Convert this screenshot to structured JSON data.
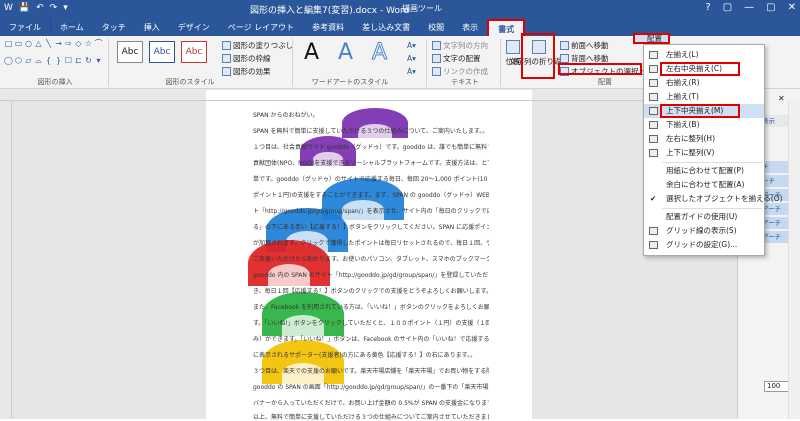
{
  "title_bar": {
    "doc_title": "図形の挿入と編集7(変習).docx - Word",
    "context_title": "描画ツール",
    "qat": [
      "W",
      "💾",
      "↶",
      "↷",
      "▾"
    ],
    "window_controls": [
      "?",
      "▢",
      "—",
      "▢",
      "✕"
    ]
  },
  "tabs": [
    "ファイル",
    "ホーム",
    "タッチ",
    "挿入",
    "デザイン",
    "ページ レイアウト",
    "参考資料",
    "差し込み文書",
    "校閲",
    "表示",
    "書式"
  ],
  "ribbon": {
    "shape_style_labels": [
      "Abc",
      "Abc",
      "Abc"
    ],
    "fill_label": "図形の塗りつぶし",
    "outline_label": "図形の枠線",
    "effects_label": "図形の効果",
    "wordart_letters": [
      "A",
      "A",
      "A"
    ],
    "text_direction_label": "文字列の方向",
    "align_text_label": "文字の配置",
    "create_link_label": "リンクの作成",
    "position_label": "位置",
    "wrap_text_label": "文字列の折り返し",
    "bring_forward_label": "前面へ移動",
    "send_backward_label": "背面へ移動",
    "selection_pane_label": "オブジェクトの選択と表示",
    "arrange_label": "配置",
    "groups": [
      "図形の挿入",
      "図形のスタイル",
      "ワードアートのスタイル",
      "テキスト",
      "配置"
    ]
  },
  "menu": {
    "items": [
      {
        "label": "左揃え(L)",
        "icon": "align-left-icon"
      },
      {
        "label": "左右中央揃え(C)",
        "icon": "align-center-icon"
      },
      {
        "label": "右揃え(R)",
        "icon": "align-right-icon"
      },
      {
        "label": "上揃え(T)",
        "icon": "align-top-icon"
      },
      {
        "label": "上下中央揃え(M)",
        "icon": "align-middle-icon"
      },
      {
        "label": "下揃え(B)",
        "icon": "align-bottom-icon"
      },
      {
        "label": "左右に整列(H)",
        "icon": "distribute-horizontal-icon"
      },
      {
        "label": "上下に整列(V)",
        "icon": "distribute-vertical-icon"
      },
      {
        "label": "用紙に合わせて配置(P)",
        "icon": ""
      },
      {
        "label": "余白に合わせて配置(A)",
        "icon": ""
      },
      {
        "label": "選択したオブジェクトを揃える(O)",
        "icon": "check-icon"
      },
      {
        "label": "配置ガイドの使用(U)",
        "icon": ""
      },
      {
        "label": "グリッド線の表示(S)",
        "icon": ""
      },
      {
        "label": "グリッドの設定(G)...",
        "icon": "grid-icon"
      }
    ]
  },
  "document": {
    "lines": [
      "SPAN からのおねがい。",
      "SPAN を無料で簡単に支援していただける３つの仕組みについて、ご案内いたします。。",
      "１つ目は、社会貢献サイト gooddo（グッドゥ）です。gooddo は、誰でも簡単に無料で社会",
      "貢献団体(NPO、NGO)を支援できるソーシャルプラットフォームです。支援方法は、とても簡",
      "単です。gooddo（グッドゥ）のサイトで応援する毎日、毎回 20～1,000 ポイント(10",
      "ポイント１円)の支援をすることができます。まず、SPAN の gooddo（グッドゥ）WEB サイ",
      "ト「http://gooddo.jp/gd/group/span/」を表示させ、サイト内の「毎日のクリックで応援す",
      "る」の下にある赤い【応援する！】ボタンをクリックしてください。SPAN に応援ポイント",
      "が加算されます。クリックで獲得したポイントは毎日リセットされるので、毎日１回、ゲーム感覚で",
      "ご支援いただけたら助かります。お使いのパソコン、タブレット、スマホのブックマークに",
      "gooddo 内の SPAN のサイト「http://gooddo.jp/gd/group/span/」を登録していただ",
      "き、毎日１回【応援する！】ボタンのクリックでの支援をどうぞよろしくお願いします。。",
      "また、Facebook を利用されている方は、「いいね！」ボタンのクリックをよろしくお願いしま",
      "す。「いいね!」ボタンをクリックしていただくと、１００ポイント（１円）の支援（１回の",
      "み）ができます。「いいね！」ボタンは、Facebook のサイト内の「いいね！で応援する」の下",
      "に表示されるサポーター(支援者)の方にある黄色【応援する！】の右にあります。。",
      "３つ目は、楽天での支援のお願いです。楽天市場店舗を「楽天市場」でお買い物をする際に、",
      "gooddo の SPAN の画面「http://gooddo.jp/gd/group/span/」の一番下の「楽天市場」の",
      "バナーから入っていただくだけで、お買い上げ金額の 0.5%が SPAN の支援金になります。。",
      "以上、無料で簡単に支援していただける３つの仕組みについてご案内させていただきました。。"
    ]
  },
  "panel": {
    "items": [
      "表示",
      "チ",
      "ーチ",
      "アーチ",
      "アーチ",
      "アーチ",
      "アーチ"
    ],
    "zoom": "100"
  },
  "colors": {
    "accent": "#2b579a",
    "highlight": "#e00000",
    "arch_colors": [
      "#7b2fb0",
      "#1e7fd8",
      "#e02020",
      "#2ab040",
      "#f2c200"
    ]
  }
}
